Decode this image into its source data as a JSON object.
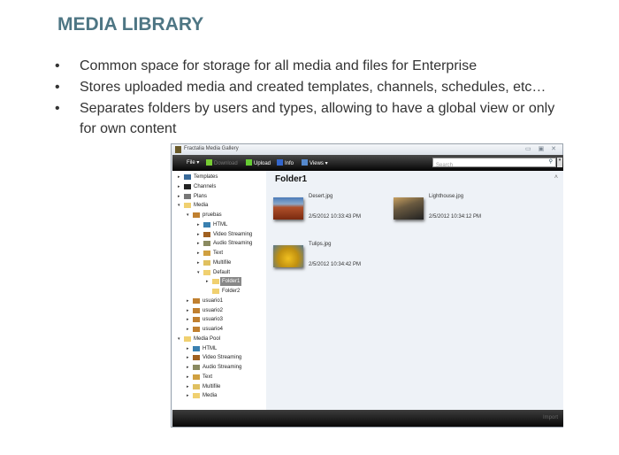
{
  "slide": {
    "title": "MEDIA LIBRARY",
    "bullets": [
      [
        "Common space for storage for all media and files for Enterprise"
      ],
      [
        "Stores uploaded media and created templates, channels, schedules, etc…"
      ],
      [
        "Separates folders by users and types, allowing to have a global view or only",
        "for own content"
      ]
    ]
  },
  "window": {
    "title": "Fractalia Media Gallery",
    "controls": "▭ ▣ ✕",
    "toolbar": {
      "file": "File ▾",
      "download": "Download",
      "upload": "Upload",
      "info": "Info",
      "views": "Views ▾",
      "search_placeholder": "Search"
    },
    "tree": [
      {
        "label": "Templates",
        "level": 0,
        "arrow": "▸",
        "icon": "templates-icon",
        "color": "#3a6a9a"
      },
      {
        "label": "Channels",
        "level": 0,
        "arrow": "▸",
        "icon": "channels-icon",
        "color": "#222"
      },
      {
        "label": "Plans",
        "level": 0,
        "arrow": "▸",
        "icon": "clock-icon",
        "color": "#777"
      },
      {
        "label": "Media",
        "level": 0,
        "arrow": "▾",
        "icon": "folder-icon",
        "color": "#f0d070"
      },
      {
        "label": "pruebas",
        "level": 1,
        "arrow": "▾",
        "icon": "user-icon",
        "color": "#c08030"
      },
      {
        "label": "HTML",
        "level": 2,
        "arrow": "▸",
        "icon": "html-icon",
        "color": "#3a80b0"
      },
      {
        "label": "Video Streaming",
        "level": 2,
        "arrow": "▸",
        "icon": "video-icon",
        "color": "#a06020"
      },
      {
        "label": "Audio Streaming",
        "level": 2,
        "arrow": "▸",
        "icon": "audio-icon",
        "color": "#8a8a60"
      },
      {
        "label": "Text",
        "level": 2,
        "arrow": "▸",
        "icon": "text-icon",
        "color": "#d0a040"
      },
      {
        "label": "Multifile",
        "level": 2,
        "arrow": "▸",
        "icon": "multifile-icon",
        "color": "#e0c060"
      },
      {
        "label": "Default",
        "level": 2,
        "arrow": "▾",
        "icon": "folder-icon",
        "color": "#f0d070"
      },
      {
        "label": "Folder1",
        "level": 3,
        "arrow": "▸",
        "icon": "folder-icon",
        "color": "#f0d070",
        "selected": true
      },
      {
        "label": "Folder2",
        "level": 3,
        "arrow": "",
        "icon": "folder-icon",
        "color": "#f0d070"
      },
      {
        "label": "usuario1",
        "level": 1,
        "arrow": "▸",
        "icon": "user-icon",
        "color": "#c08030"
      },
      {
        "label": "usuario2",
        "level": 1,
        "arrow": "▸",
        "icon": "user-icon",
        "color": "#c08030"
      },
      {
        "label": "usuario3",
        "level": 1,
        "arrow": "▸",
        "icon": "user-icon",
        "color": "#c08030"
      },
      {
        "label": "usuario4",
        "level": 1,
        "arrow": "▸",
        "icon": "user-icon",
        "color": "#c08030"
      },
      {
        "label": "Media Pool",
        "level": 0,
        "arrow": "▾",
        "icon": "folder-icon",
        "color": "#f0d070"
      },
      {
        "label": "HTML",
        "level": 1,
        "arrow": "▸",
        "icon": "html-icon",
        "color": "#3a80b0"
      },
      {
        "label": "Video Streaming",
        "level": 1,
        "arrow": "▸",
        "icon": "video-icon",
        "color": "#a06020"
      },
      {
        "label": "Audio Streaming",
        "level": 1,
        "arrow": "▸",
        "icon": "audio-icon",
        "color": "#8a8a60"
      },
      {
        "label": "Text",
        "level": 1,
        "arrow": "▸",
        "icon": "text-icon",
        "color": "#d0a040"
      },
      {
        "label": "Multifile",
        "level": 1,
        "arrow": "▸",
        "icon": "multifile-icon",
        "color": "#e0c060"
      },
      {
        "label": "Media",
        "level": 1,
        "arrow": "▸",
        "icon": "folder-icon",
        "color": "#f0d070"
      }
    ],
    "content": {
      "folder": "Folder1",
      "items": [
        {
          "name": "Desert.jpg",
          "date": "2/5/2012 10:33:43 PM",
          "thumb": "linear-gradient(#4a7ab8 0%,#8aa8c8 30%,#b0502a 45%,#7a2a10 100%)"
        },
        {
          "name": "Lighthouse.jpg",
          "date": "2/5/2012 10:34:12 PM",
          "thumb": "linear-gradient(160deg,#c8a060 0%,#6a5a40 40%,#222 100%)"
        },
        {
          "name": "Tulips.jpg",
          "date": "2/5/2012 10:34:42 PM",
          "thumb": "radial-gradient(circle at 50% 60%,#f0c020,#c09010 50%,#5a7a90 100%)"
        }
      ]
    },
    "status": {
      "import": "Import"
    }
  }
}
